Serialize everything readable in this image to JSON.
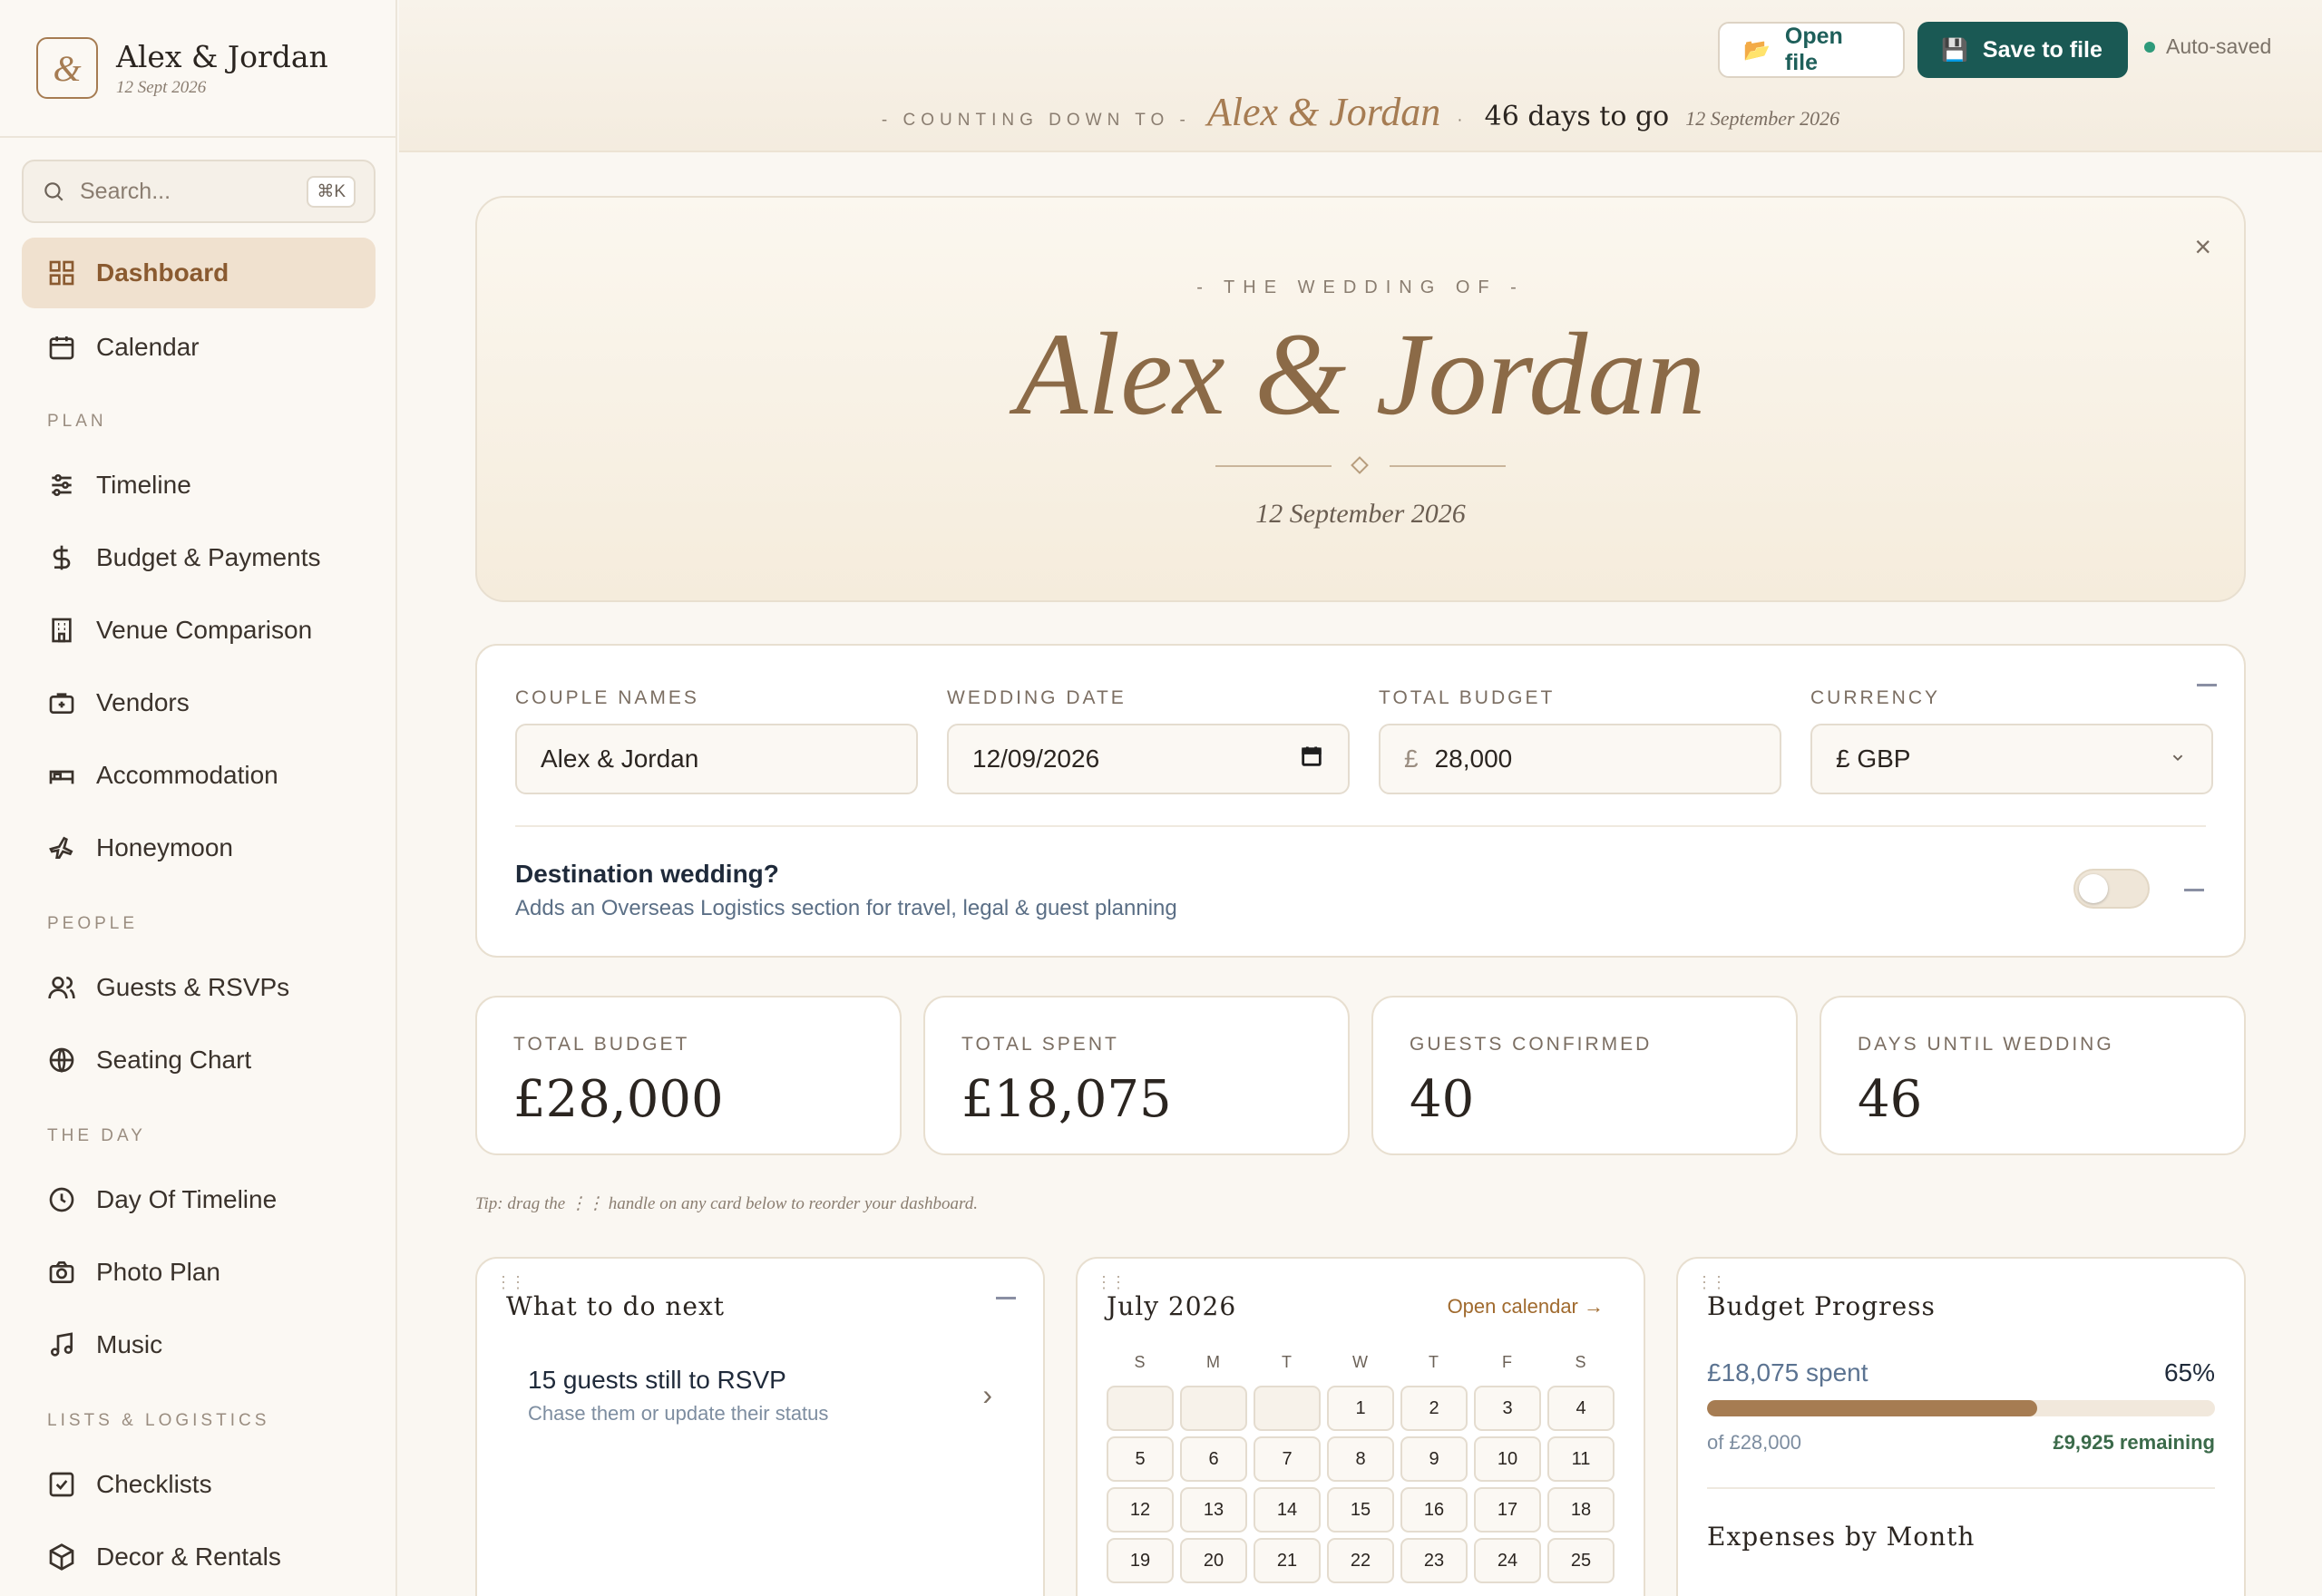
{
  "brand": {
    "name": "Alex & Jordan",
    "date": "12 Sept 2026",
    "logo_glyph": "&"
  },
  "search": {
    "placeholder": "Search...",
    "shortcut": "⌘K"
  },
  "nav": {
    "dashboard": "Dashboard",
    "calendar": "Calendar",
    "section_plan": "PLAN",
    "timeline": "Timeline",
    "budget": "Budget & Payments",
    "venue": "Venue Comparison",
    "vendors": "Vendors",
    "accommodation": "Accommodation",
    "honeymoon": "Honeymoon",
    "section_people": "PEOPLE",
    "guests": "Guests & RSVPs",
    "seating": "Seating Chart",
    "section_day": "THE DAY",
    "day_timeline": "Day Of Timeline",
    "photo": "Photo Plan",
    "music": "Music",
    "section_lists": "LISTS & LOGISTICS",
    "checklists": "Checklists",
    "decor": "Decor & Rentals"
  },
  "topbar": {
    "open_file": "Open file",
    "save_file": "Save to file",
    "autosaved": "Auto-saved",
    "countdown_label": "- COUNTING DOWN TO -",
    "countdown_names": "Alex & Jordan",
    "countdown_dot": "·",
    "countdown_days": "46 days to go",
    "countdown_date": "12 September 2026"
  },
  "hero": {
    "kicker": "- THE WEDDING OF -",
    "names": "Alex & Jordan",
    "date": "12 September 2026",
    "close": "×"
  },
  "settings": {
    "couple_label": "COUPLE NAMES",
    "couple_value": "Alex & Jordan",
    "date_label": "WEDDING DATE",
    "date_value": "12/09/2026",
    "budget_label": "TOTAL BUDGET",
    "budget_prefix": "£",
    "budget_value": "28,000",
    "currency_label": "CURRENCY",
    "currency_value": "£ GBP",
    "destination_title": "Destination wedding?",
    "destination_sub": "Adds an Overseas Logistics section for travel, legal & guest planning",
    "destination_enabled": false
  },
  "stats": [
    {
      "label": "TOTAL BUDGET",
      "value": "£28,000"
    },
    {
      "label": "TOTAL SPENT",
      "value": "£18,075"
    },
    {
      "label": "GUESTS CONFIRMED",
      "value": "40"
    },
    {
      "label": "DAYS UNTIL WEDDING",
      "value": "46"
    }
  ],
  "tip": "Tip: drag the ⋮⋮ handle on any card below to reorder your dashboard.",
  "todo": {
    "title": "What to do next",
    "item_title": "15 guests still to RSVP",
    "item_sub": "Chase them or update their status"
  },
  "calendar": {
    "month": "July 2026",
    "link": "Open calendar →",
    "weekdays": [
      "S",
      "M",
      "T",
      "W",
      "T",
      "F",
      "S"
    ],
    "leading_blanks": 3,
    "days": [
      "1",
      "2",
      "3",
      "4",
      "5",
      "6",
      "7",
      "8",
      "9",
      "10",
      "11",
      "12",
      "13",
      "14",
      "15",
      "16",
      "17",
      "18",
      "19",
      "20",
      "21",
      "22",
      "23",
      "24",
      "25"
    ]
  },
  "budget_progress": {
    "title": "Budget Progress",
    "spent": "£18,075 spent",
    "percent_label": "65%",
    "percent": 65,
    "of_total": "of £28,000",
    "remaining": "£9,925 remaining",
    "expenses_title": "Expenses by Month"
  },
  "colors": {
    "accent": "#a67c52",
    "primary": "#1a5954",
    "active_nav_bg": "#f0e1cf"
  }
}
